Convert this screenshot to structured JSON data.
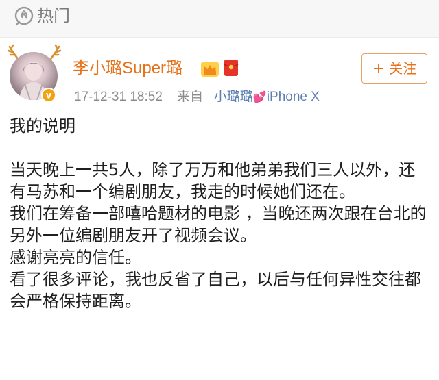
{
  "topbar": {
    "label": "热门",
    "icon": "hot-fire-icon"
  },
  "author": {
    "name": "李小璐Super璐",
    "avatar": "avatar-icon",
    "badges": [
      "verified-badge-icon",
      "crown-icon",
      "red-packet-icon"
    ]
  },
  "post_meta": {
    "timestamp": "17-12-31 18:52",
    "from_label": "来自",
    "source_name": "小璐璐",
    "source_heart": "💕",
    "source_device": "iPhone X"
  },
  "follow_button": {
    "plus": "+",
    "label": "关注"
  },
  "post": {
    "title": "我的说明",
    "paragraph1": "当天晚上一共5人，除了万万和他弟弟我们三人以外，还有马苏和一个编剧朋友，我走的时候她们还在。",
    "paragraph2": "我们在筹备一部嘻哈题材的电影 ，当晚还两次跟在台北的另外一位编剧朋友开了视频会议。",
    "paragraph3": "感谢亮亮的信任。",
    "paragraph4": "看了很多评论，我也反省了自己，以后与任何异性交往都会严格保持距离。"
  },
  "colors": {
    "username": "#e8721a",
    "source_link": "#5c7fb0",
    "meta_text": "#8b8b8b",
    "body_text": "#1f1f1f"
  }
}
